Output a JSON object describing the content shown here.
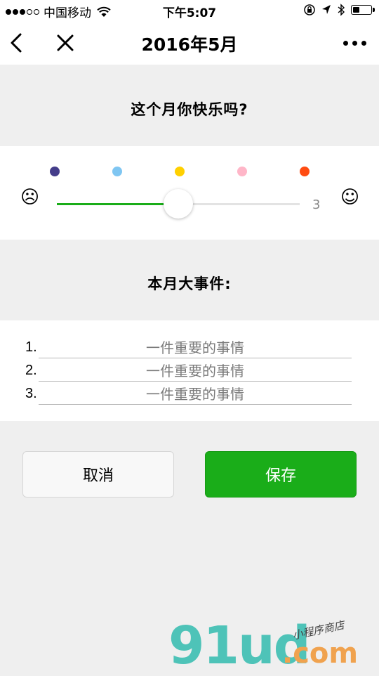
{
  "status_bar": {
    "carrier": "中国移动",
    "time": "下午5:07"
  },
  "nav": {
    "title": "2016年5月"
  },
  "mood": {
    "question": "这个月你快乐吗?",
    "dots": [
      "#443d8a",
      "#7fc6f2",
      "#ffd000",
      "#ffb6c8",
      "#ff4c12"
    ],
    "sad_face": "☹",
    "happy_face": "☺",
    "value": 3,
    "value_label": "3",
    "min": 1,
    "max": 5,
    "track_fill_color": "#1aad19"
  },
  "events": {
    "title": "本月大事件:",
    "items": [
      {
        "number": "1.",
        "placeholder": "一件重要的事情",
        "value": ""
      },
      {
        "number": "2.",
        "placeholder": "一件重要的事情",
        "value": ""
      },
      {
        "number": "3.",
        "placeholder": "一件重要的事情",
        "value": ""
      }
    ]
  },
  "buttons": {
    "cancel_label": "取消",
    "save_label": "保存",
    "save_color": "#1aad19"
  },
  "watermark": {
    "main": "91ud",
    "domain": ".com",
    "sub": "小程序商店"
  }
}
